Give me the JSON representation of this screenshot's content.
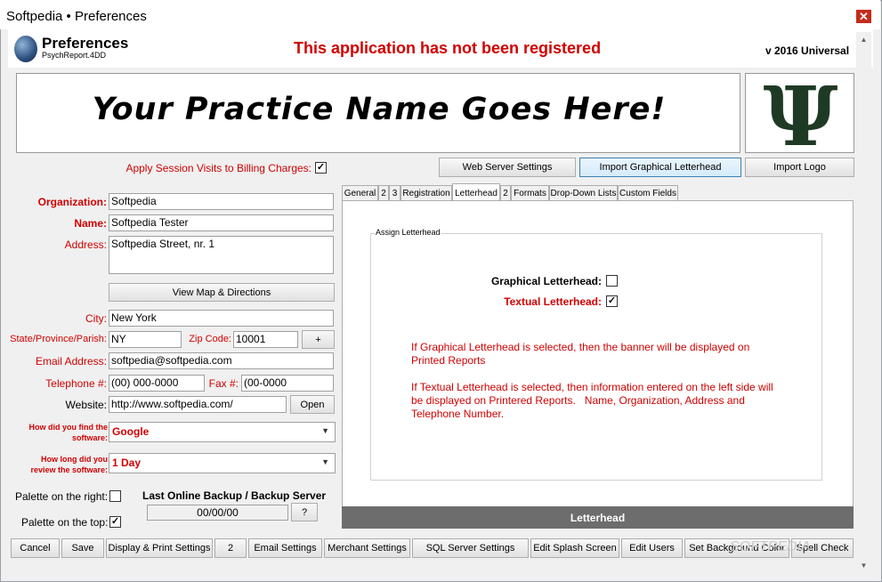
{
  "window": {
    "title": "Softpedia  • Preferences",
    "close_label": "✕"
  },
  "header": {
    "title": "Preferences",
    "subtitle": "PsychReport.4DD",
    "notice": "This application has not been registered",
    "version": "v 2016 Universal"
  },
  "banner": {
    "text": "Your Practice Name Goes Here!",
    "logo_glyph": "Ψ"
  },
  "top_buttons": {
    "web_server": "Web Server Settings",
    "import_letterhead": "Import Graphical Letterhead",
    "import_logo": "Import Logo"
  },
  "form": {
    "apply_session_label": "Apply Session Visits to Billing Charges:",
    "apply_session_checked": "✓",
    "organization_label": "Organization:",
    "organization_value": "Softpedia",
    "name_label": "Name:",
    "name_value": "Softpedia Tester",
    "address_label": "Address:",
    "address_value": "Softpedia Street, nr. 1",
    "view_map": "View Map & Directions",
    "city_label": "City:",
    "city_value": "New York",
    "state_label": "State/Province/Parish:",
    "state_value": "NY",
    "zip_label": "Zip Code:",
    "zip_value": "10001",
    "plus_label": "+",
    "email_label": "Email Address:",
    "email_value": "softpedia@softpedia.com",
    "phone_label": "Telephone #:",
    "phone_value": "(00) 000-0000",
    "fax_label": "Fax #:",
    "fax_value": "(00-0000",
    "website_label": "Website:",
    "website_value": "http://www.softpedia.com/",
    "open_label": "Open",
    "find_label_1": "How did you find the",
    "find_label_2": "software:",
    "find_value": "Google",
    "review_label_1": "How long did you",
    "review_label_2": "review the software:",
    "review_value": "1 Day",
    "palette_right_label": "Palette on the right:",
    "palette_right_checked": "",
    "palette_top_label": "Palette on the top:",
    "palette_top_checked": "✓",
    "backup_label": "Last Online Backup / Backup Server",
    "backup_value": "00/00/00",
    "help_label": "?"
  },
  "tabs": [
    {
      "label": "General"
    },
    {
      "label": "2"
    },
    {
      "label": "3"
    },
    {
      "label": "Registration"
    },
    {
      "label": "Letterhead"
    },
    {
      "label": "2"
    },
    {
      "label": "Formats"
    },
    {
      "label": "Drop-Down Lists"
    },
    {
      "label": "Custom Fields"
    }
  ],
  "letterhead": {
    "group_label": "Assign Letterhead",
    "graphical_label": "Graphical Letterhead:",
    "graphical_checked": "",
    "textual_label": "Textual Letterhead:",
    "textual_checked": "✓",
    "info_1a": "If Graphical Letterhead is selected, then the banner will be displayed on",
    "info_1b": "Printed Reports",
    "info_2a": "If Textual Letterhead is selected, then information entered on the left side will",
    "info_2b": "be displayed on Printered Reports.   Name, Organization, Address and",
    "info_2c": "Telephone Number.",
    "footer": "Letterhead"
  },
  "bottom_buttons": [
    {
      "label": "Cancel"
    },
    {
      "label": "Save"
    },
    {
      "label": "Display & Print Settings"
    },
    {
      "label": "2"
    },
    {
      "label": "Email Settings"
    },
    {
      "label": "Merchant Settings"
    },
    {
      "label": "SQL Server Settings"
    },
    {
      "label": "Edit Splash Screen"
    },
    {
      "label": "Edit Users"
    },
    {
      "label": "Set Background Color"
    },
    {
      "label": "Spell Check"
    }
  ],
  "watermark": "SOFTPEDIA"
}
